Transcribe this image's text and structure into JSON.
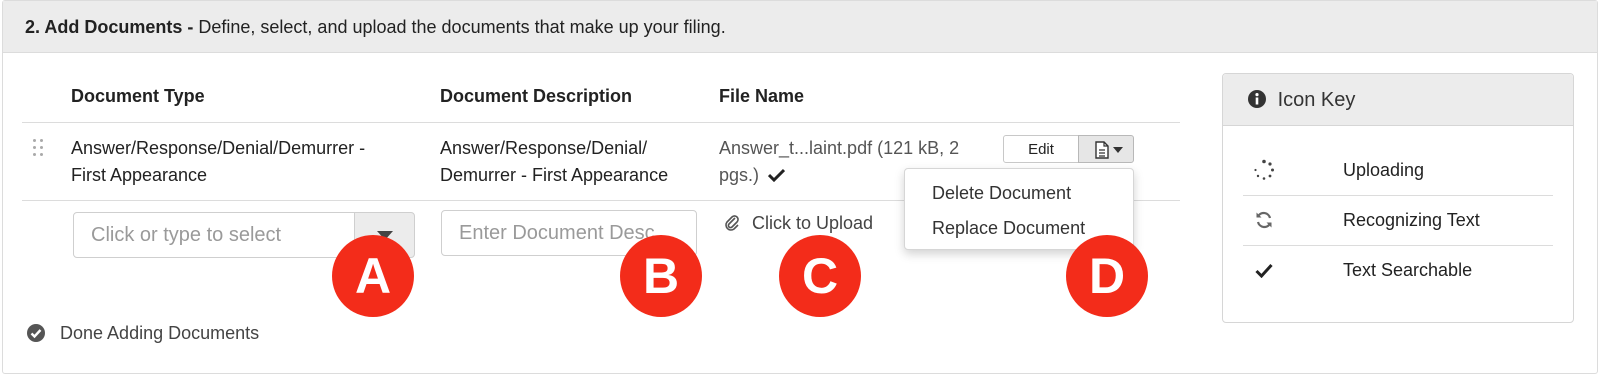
{
  "heading": {
    "number_title": "2. Add Documents -",
    "subtitle": "Define, select, and upload the documents that make up your filing."
  },
  "table": {
    "columns": [
      "Document Type",
      "Document Description",
      "File Name"
    ],
    "row": {
      "type_line1": "Answer/Response/Denial/Demurrer -",
      "type_line2": "First Appearance",
      "desc_line1": "Answer/Response/Denial/",
      "desc_line2": "Demurrer - First Appearance",
      "file_line1": "Answer_t...laint.pdf (121 kB, 2",
      "file_line2": "pgs.)",
      "edit_label": "Edit"
    }
  },
  "dropdown": {
    "items": [
      "Delete Document",
      "Replace Document"
    ]
  },
  "new_row": {
    "type_placeholder": "Click or type to select",
    "desc_placeholder": "Enter Document Desc",
    "upload_label": "Click to Upload"
  },
  "markers": [
    "A",
    "B",
    "C",
    "D"
  ],
  "done_label": "Done Adding Documents",
  "icon_key": {
    "title": "Icon Key",
    "items": [
      {
        "icon": "spinner-icon",
        "label": "Uploading"
      },
      {
        "icon": "refresh-icon",
        "label": "Recognizing Text"
      },
      {
        "icon": "check-icon",
        "label": "Text Searchable"
      }
    ]
  },
  "colors": {
    "marker": "#f32c1a",
    "heading_bg": "#ececec"
  }
}
